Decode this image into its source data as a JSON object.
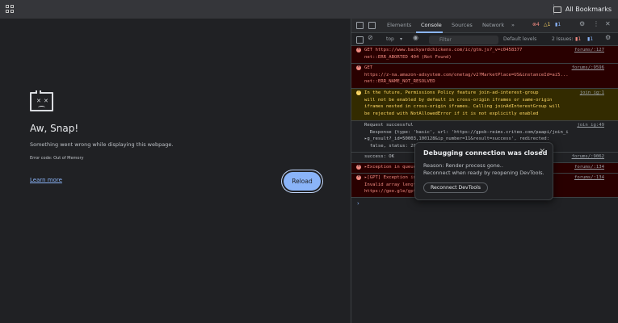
{
  "browser": {
    "bookmarks_label": "All Bookmarks"
  },
  "crash_page": {
    "title": "Aw, Snap!",
    "message": "Something went wrong while displaying this webpage.",
    "error_code": "Error code: Out of Memory",
    "learn_more": "Learn more",
    "reload": "Reload"
  },
  "devtools": {
    "tabs": [
      "Elements",
      "Console",
      "Sources",
      "Network"
    ],
    "active_tab": "Console",
    "more_tabs": "»",
    "badges": {
      "errors": "4",
      "warnings": "1",
      "info": "1"
    },
    "toolbar": {
      "context": "top",
      "filter_placeholder": "Filter",
      "levels": "Default levels",
      "issues_label": "2 Issues:",
      "issue_errors": "1",
      "issue_info": "1"
    },
    "messages": [
      {
        "type": "error",
        "text": "GET https://www.backyardchickens.com/ic/gtm.js?_v=c0458377\nnet::ERR_ABORTED 404 (Not Found)",
        "source": "forums/:127"
      },
      {
        "type": "error",
        "text": "GET\nhttps://z-na.amazon-adsystem.com/onetag/v2?MarketPlace=US&instanceId=ai5...\nnet::ERR_NAME_NOT_RESOLVED",
        "source": "forums/:9596"
      },
      {
        "type": "warning",
        "text": "In the future, Permissions Policy feature join-ad-interest-group\nwill not be enabled by default in cross-origin iframes or same-origin\niframes nested in cross-origin iframes. Calling joinAdInterestGroup will\nbe rejected with NotAllowedError if it is not explicitly enabled",
        "source": "join_ig:1"
      },
      {
        "type": "info",
        "text": "Request successful\n  Response {type: 'basic', url: 'https://gpsb-reims.criteo.com/paapi/join_i\n▸g_result?_id=50003,100128&ip_number=11&result=success', redirected:\n  false, status: 200, ...}",
        "source": "join_ig:49"
      },
      {
        "type": "info",
        "text": "success: OK",
        "source": "forums/:9062"
      },
      {
        "type": "error",
        "text": "▸Exception in queue",
        "source": "forums/:134"
      },
      {
        "type": "error",
        "text": "▸[GPT] Exception in queue\nInvalid array length\nhttps://goo.gle/gpt-message...",
        "source": "forums/:134"
      }
    ],
    "prompt": "›"
  },
  "dialog": {
    "title": "Debugging connection was closed",
    "reason": "Reason: Render process gone..",
    "message": "Reconnect when ready by reopening DevTools.",
    "button": "Reconnect DevTools",
    "close": "✕"
  }
}
